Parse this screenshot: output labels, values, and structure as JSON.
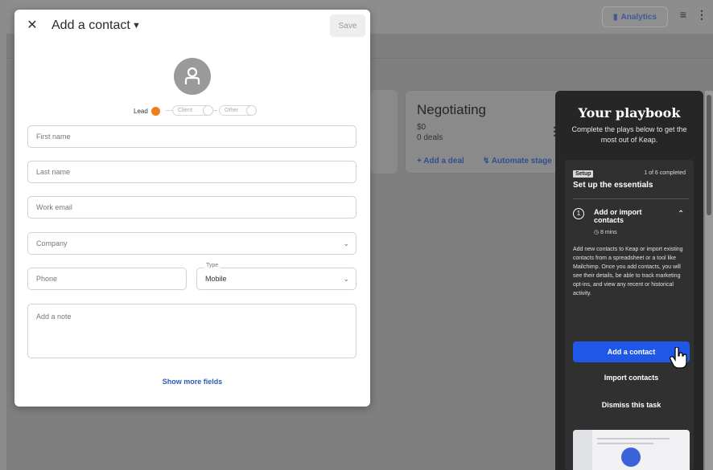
{
  "modal": {
    "title": "Add a contact",
    "save_label": "Save",
    "status": {
      "lead": "Lead",
      "client": "Client",
      "other": "Other",
      "selected": "Lead"
    },
    "fields": {
      "first_name": "First name",
      "last_name": "Last name",
      "work_email": "Work email",
      "company": "Company",
      "phone": "Phone",
      "type_label": "Type",
      "type_value": "Mobile",
      "note": "Add a note"
    },
    "show_more": "Show more fields"
  },
  "background": {
    "analytics_label": "Analytics",
    "stage": {
      "title": "Negotiating",
      "sum": "$0",
      "deals": "0 deals",
      "add_deal": "+ Add a deal",
      "automate": "Automate stage"
    }
  },
  "playbook": {
    "title": "Your playbook",
    "subtitle": "Complete the plays below to get the most out of Keap.",
    "tag": "Setup",
    "progress": "1 of 6 completed",
    "section_title": "Set up the essentials",
    "step_number": "1",
    "task_title": "Add or import contacts",
    "duration": "8 mins",
    "description": "Add new contacts to Keap or import existing contacts from a spreadsheet or a tool like Mailchimp. Once you add contacts, you will see their details, be able to track marketing opt-ins, and view any recent or historical activity.",
    "primary_button": "Add a contact",
    "import_link": "Import contacts",
    "dismiss_link": "Dismiss this task"
  },
  "colors": {
    "accent_orange": "#f07d1a",
    "primary_blue": "#1f58e6",
    "link_blue": "#2c59b8",
    "panel_dark": "#262626"
  },
  "icons": {
    "close": "close-icon",
    "chevron": "chevron-down-icon",
    "avatar": "user-icon",
    "clock": "clock-icon",
    "caret_up": "chevron-up-icon",
    "filter": "filter-icon",
    "kebab": "more-vertical-icon",
    "analytics": "bar-chart-icon"
  }
}
